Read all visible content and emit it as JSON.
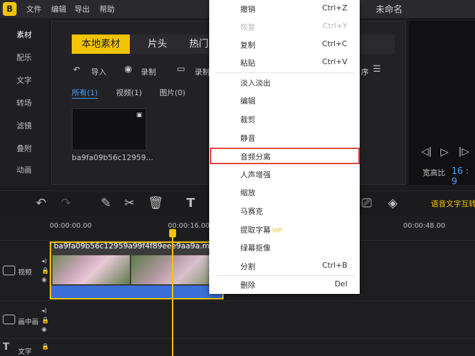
{
  "app": {
    "window_title": "未命名",
    "logo_text": "B"
  },
  "menu_bar": [
    "文件",
    "编辑",
    "导出",
    "帮助"
  ],
  "sidebar": [
    "素材",
    "配乐",
    "文字",
    "转场",
    "滤镜",
    "叠附",
    "动画"
  ],
  "material_tabs": [
    "本地素材",
    "片头",
    "热门"
  ],
  "toolbar": {
    "import": "导入",
    "record": "录制",
    "record2": "录制",
    "sort": "序"
  },
  "filters": [
    "所有(1)",
    "视频(1)",
    "图片(0)"
  ],
  "media_item": {
    "name": "ba9fa09b56c12959..."
  },
  "preview": {
    "ratio_label": "宽高比",
    "ratio_value": "16 : 9"
  },
  "edit_toolbar": {
    "speech_to_text": "语音文字互转"
  },
  "timeline": {
    "ruler": [
      "00:00:00.00",
      "00:00:16.00",
      "00:00:48.00"
    ],
    "tracks": [
      "视频",
      "画中画",
      "文字"
    ],
    "clip_name": "ba9fa09b56c12959a99f4f89eee9aa9a.mp4"
  },
  "context_menu": {
    "items": [
      {
        "label": "撤销",
        "shortcut": "Ctrl+Z",
        "disabled": false
      },
      {
        "label": "恢复",
        "shortcut": "Ctrl+Y",
        "disabled": true
      },
      {
        "label": "复制",
        "shortcut": "Ctrl+C",
        "disabled": false
      },
      {
        "label": "粘贴",
        "shortcut": "Ctrl+V",
        "disabled": false
      },
      {
        "label": "淡入淡出",
        "shortcut": "",
        "disabled": false
      },
      {
        "label": "编辑",
        "shortcut": "",
        "disabled": false
      },
      {
        "label": "裁剪",
        "shortcut": "",
        "disabled": false
      },
      {
        "label": "静音",
        "shortcut": "",
        "disabled": false
      },
      {
        "label": "音频分离",
        "shortcut": "",
        "disabled": false
      },
      {
        "label": "人声增强",
        "shortcut": "",
        "disabled": false
      },
      {
        "label": "缩放",
        "shortcut": "",
        "disabled": false
      },
      {
        "label": "马赛克",
        "shortcut": "",
        "disabled": false
      },
      {
        "label": "提取字幕",
        "shortcut": "",
        "disabled": false,
        "badge": "VIP"
      },
      {
        "label": "绿幕抠像",
        "shortcut": "",
        "disabled": false
      },
      {
        "label": "分割",
        "shortcut": "Ctrl+B",
        "disabled": false
      },
      {
        "label": "删除",
        "shortcut": "Del",
        "disabled": false
      }
    ]
  },
  "colors": {
    "accent": "#f5c400",
    "highlight_border": "#e0443a",
    "link_blue": "#4aa3ff"
  }
}
